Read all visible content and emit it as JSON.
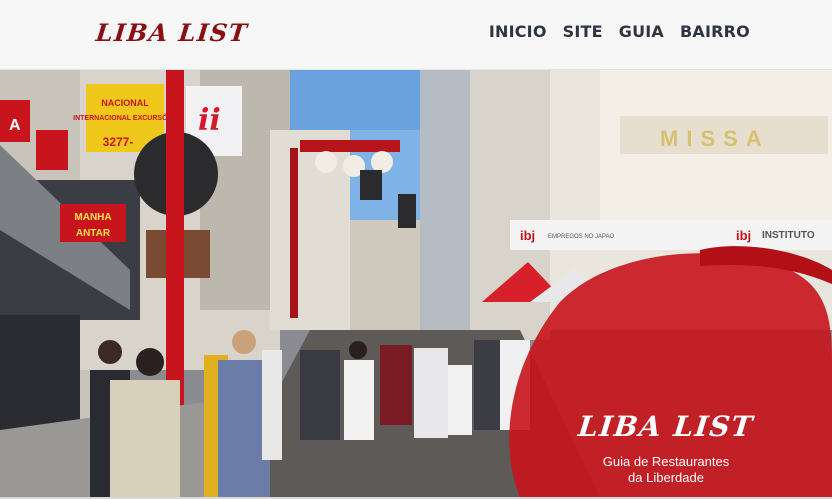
{
  "header": {
    "logo": "LIBA LIST",
    "nav": [
      {
        "label": "INICIO"
      },
      {
        "label": "SITE"
      },
      {
        "label": "GUIA"
      },
      {
        "label": "BAIRRO"
      }
    ]
  },
  "hero": {
    "title": "LIBA LIST",
    "subtitle_line1": "Guia de Restaurantes",
    "subtitle_line2": "da Liberdade",
    "signs": {
      "manha": "MANHA",
      "antar": "ANTAR",
      "ibj_left": "ibj",
      "ibj_right": "ibj",
      "instituto": "INSTITUTO",
      "missa": "MISSA",
      "empregos": "EMPREGOS NO JAPAO",
      "nacional": "NACIONAL",
      "excursoes": "INTERNACIONAL EXCURSÕES",
      "phone": "3277-",
      "letter_a": "A",
      "letters_ii": "ii"
    }
  },
  "colors": {
    "brand_red": "#8b0e12",
    "nav_text": "#2e3442",
    "brush_red": "#c8141c"
  }
}
